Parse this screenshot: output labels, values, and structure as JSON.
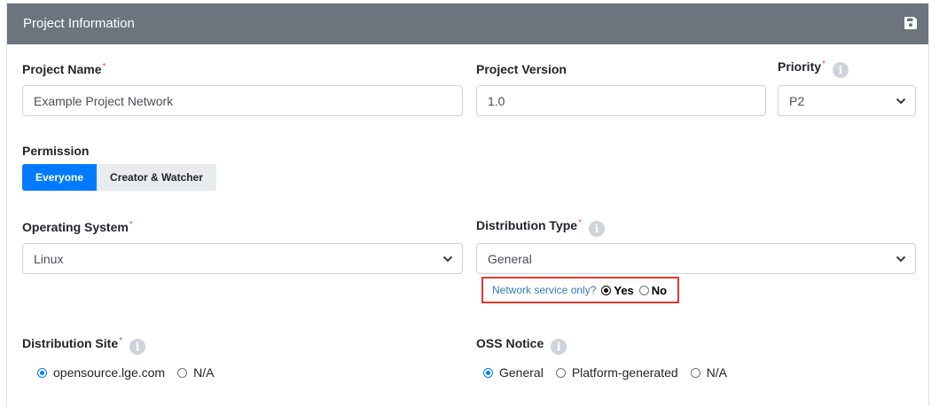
{
  "header": {
    "title": "Project Information",
    "save_icon": "save-icon"
  },
  "fields": {
    "project_name": {
      "label": "Project Name",
      "required_mark": "*",
      "value": "Example Project Network"
    },
    "project_version": {
      "label": "Project Version",
      "value": "1.0"
    },
    "priority": {
      "label": "Priority",
      "required_mark": "*",
      "info": "i",
      "value": "P2"
    },
    "permission": {
      "label": "Permission",
      "options": [
        "Everyone",
        "Creator & Watcher"
      ],
      "selected": "Everyone"
    },
    "operating_system": {
      "label": "Operating System",
      "required_mark": "*",
      "value": "Linux"
    },
    "distribution_type": {
      "label": "Distribution Type",
      "required_mark": "*",
      "info": "i",
      "value": "General"
    },
    "network_service": {
      "question": "Network service only?",
      "options": [
        "Yes",
        "No"
      ],
      "selected": "Yes"
    },
    "distribution_site": {
      "label": "Distribution Site",
      "required_mark": "*",
      "info": "i",
      "options": [
        "opensource.lge.com",
        "N/A"
      ],
      "selected": "opensource.lge.com"
    },
    "oss_notice": {
      "label": "OSS Notice",
      "info": "i",
      "options": [
        "General",
        "Platform-generated",
        "N/A"
      ],
      "selected": "General"
    }
  },
  "colors": {
    "header_bg": "#6c757d",
    "accent": "#007bff",
    "required": "#e74c3c",
    "highlight_border": "#e03a2f",
    "link": "#337ab7"
  }
}
